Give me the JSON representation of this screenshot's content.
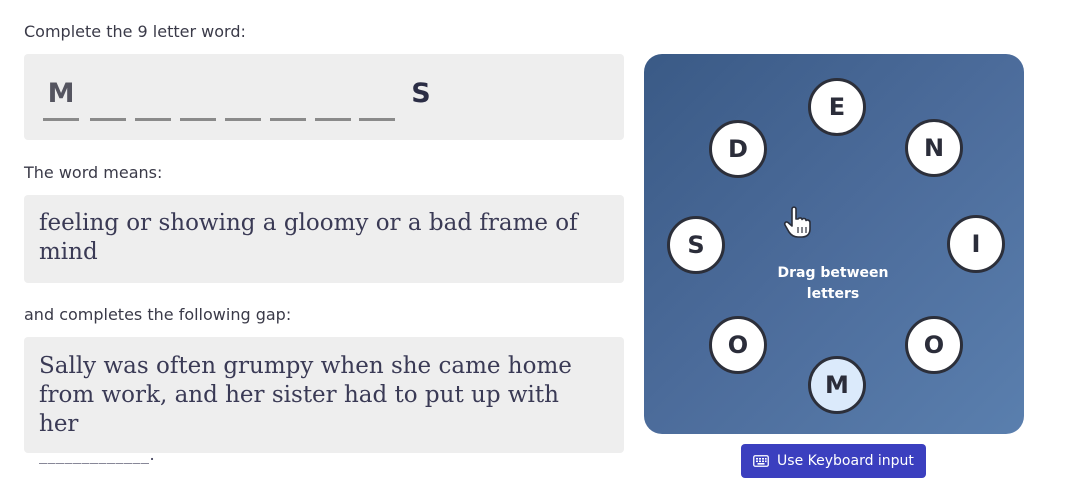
{
  "instructions": {
    "complete_label": "Complete the 9 letter word:",
    "means_label": "The word means:",
    "gap_label": "and completes the following gap:"
  },
  "word": {
    "first_letter": "M",
    "last_letter": "S",
    "length": 9
  },
  "definition": "feeling or showing a gloomy or a bad frame of mind",
  "gap_sentence": {
    "text": "Sally was often grumpy when she came home from work, and her sister had to put up with her",
    "blank": "_____________."
  },
  "wheel": {
    "letters": [
      {
        "letter": "E",
        "selected": false
      },
      {
        "letter": "N",
        "selected": false
      },
      {
        "letter": "I",
        "selected": false
      },
      {
        "letter": "O",
        "selected": false
      },
      {
        "letter": "M",
        "selected": true
      },
      {
        "letter": "O",
        "selected": false
      },
      {
        "letter": "S",
        "selected": false
      },
      {
        "letter": "D",
        "selected": false
      }
    ],
    "hint": "Drag between letters",
    "hint_icon": "pointer-hand-icon"
  },
  "keyboard_button": {
    "label": "Use Keyboard input",
    "icon": "keyboard-icon"
  },
  "colors": {
    "wheel_top": "#3a5a86",
    "wheel_bottom": "#5a7fae",
    "button": "#3b3fbf",
    "selected_bubble": "#dbeafb"
  }
}
